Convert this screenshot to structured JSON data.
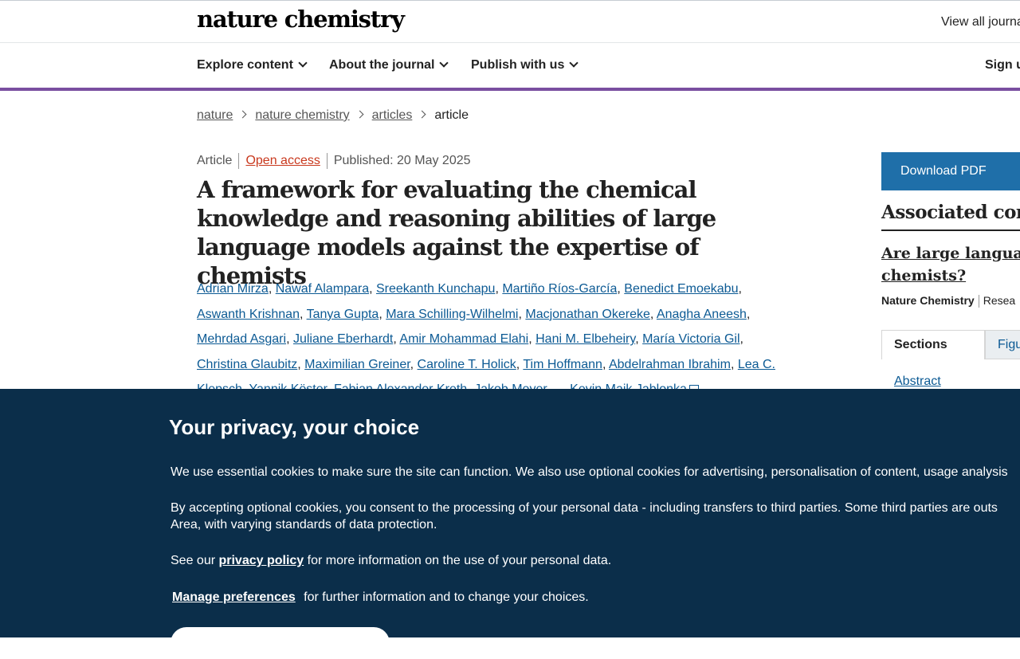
{
  "header": {
    "brand": "nature chemistry",
    "view_all": "View all journa"
  },
  "nav": {
    "items": [
      "Explore content",
      "About the journal",
      "Publish with us"
    ],
    "sign_in": "Sign u"
  },
  "breadcrumb": [
    "nature",
    "nature chemistry",
    "articles",
    "article"
  ],
  "article": {
    "type": "Article",
    "open_access": "Open access",
    "published": "Published: 20 May 2025",
    "title": "A framework for evaluating the chemical knowledge and reasoning abilities of large language models against the expertise of chemists",
    "authors": [
      "Adrian Mirza",
      "Nawaf Alampara",
      "Sreekanth Kunchapu",
      "Martiño Ríos-García",
      "Benedict Emoekabu",
      "Aswanth Krishnan",
      "Tanya Gupta",
      "Mara Schilling-Wilhelmi",
      "Macjonathan Okereke",
      "Anagha Aneesh",
      "Mehrdad Asgari",
      "Juliane Eberhardt",
      "Amir Mohammad Elahi",
      "Hani M. Elbeheiry",
      "María Victoria Gil",
      "Christina Glaubitz",
      "Maximilian Greiner",
      "Caroline T. Holick",
      "Tim Hoffmann",
      "Abdelrahman Ibrahim",
      "Lea C.",
      "Klepsch",
      "Yannik Köster",
      "Fabian Alexander Kreth",
      "Jakob Meyer",
      "Kevin Maik Jablonka"
    ],
    "ellipsis": "…"
  },
  "sidebar": {
    "download": "Download PDF",
    "assoc_heading": "Associated cont",
    "assoc_title_line1": "Are large language",
    "assoc_title_line2": "chemists?",
    "assoc_journal": "Nature Chemistry",
    "assoc_type": "Resea",
    "tabs": [
      "Sections",
      "Figu"
    ],
    "abstract": "Abstract"
  },
  "cookie": {
    "heading": "Your privacy, your choice",
    "p1": "We use essential cookies to make sure the site can function. We also use optional cookies for advertising, personalisation of content, usage analysis",
    "p2_line1": "By accepting optional cookies, you consent to the processing of your personal data - including transfers to third parties. Some third parties are outs",
    "p2_line2": "Area, with varying standards of data protection.",
    "p3_pre": "See our ",
    "p3_link": "privacy policy",
    "p3_post": " for more information on the use of your personal data.",
    "p4_link": "Manage preferences",
    "p4_post": " for further information and to change your choices."
  }
}
